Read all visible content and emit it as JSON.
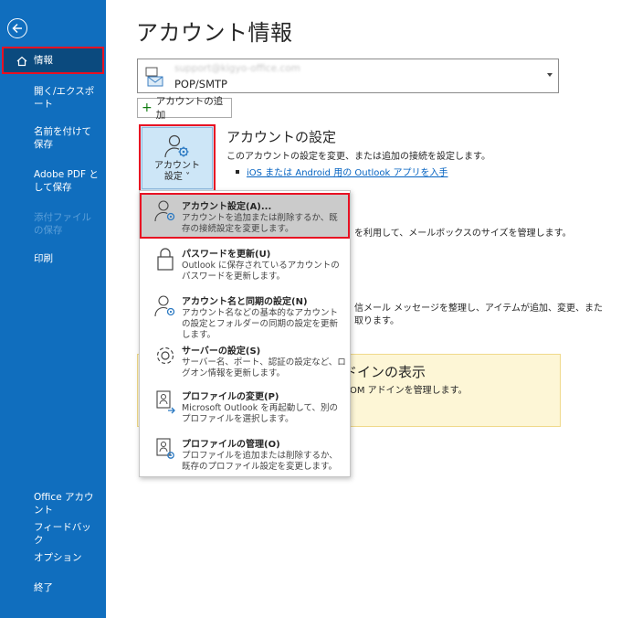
{
  "sidebar": {
    "back_icon": "arrow-left-circle-icon",
    "items": [
      {
        "label": "情報",
        "state": "active",
        "icon": "home-icon"
      },
      {
        "label": "開く/エクスポート",
        "state": "normal"
      },
      {
        "label": "名前を付けて保存",
        "state": "normal"
      },
      {
        "label": "Adobe PDF として保存",
        "state": "normal"
      },
      {
        "label": "添付ファイルの保存",
        "state": "disabled"
      },
      {
        "label": "印刷",
        "state": "normal"
      },
      {
        "label": "Office アカウント",
        "state": "normal"
      },
      {
        "label": "フィードバック",
        "state": "normal"
      },
      {
        "label": "オプション",
        "state": "normal"
      },
      {
        "label": "終了",
        "state": "normal"
      }
    ]
  },
  "main": {
    "title": "アカウント情報",
    "account": {
      "email": "support@kigyo-office.com",
      "type": "POP/SMTP",
      "icon": "mail-account-icon"
    },
    "add_account_label": "アカウントの追加",
    "account_settings_button": {
      "line1": "アカウント",
      "line2": "設定 ˅",
      "icon": "person-gear-icon"
    },
    "section": {
      "title": "アカウントの設定",
      "desc": "このアカウントの設定を変更、または追加の接続を設定します。",
      "link": "iOS または Android 用の Outlook アプリを入手"
    },
    "bg_text_1": "を利用して、メールボックスのサイズを管理します。",
    "bg_text_2": "信メール メッセージを整理し、アイテムが追加、変更、また",
    "bg_text_3": "取ります。",
    "addin": {
      "title": "ドインの表示",
      "desc": "COM アドインを管理します。"
    }
  },
  "menu": {
    "items": [
      {
        "title": "アカウント設定(A)...",
        "key": "A",
        "desc": "アカウントを追加または削除するか、既存の接続設定を変更します。",
        "icon": "person-gear-icon",
        "highlighted": true
      },
      {
        "title": "パスワードを更新(U)",
        "key": "U",
        "desc": "Outlook に保存されているアカウントのパスワードを更新します。",
        "icon": "lock-icon"
      },
      {
        "title": "アカウント名と同期の設定(N)",
        "key": "N",
        "desc": "アカウント名などの基本的なアカウントの設定とフォルダーの同期の設定を更新します。",
        "icon": "person-gear-icon"
      },
      {
        "title": "サーバーの設定(S)",
        "key": "S",
        "desc": "サーバー名、ポート、認証の設定など、ログオン情報を更新します。",
        "icon": "gear-icon"
      },
      {
        "title": "プロファイルの変更(P)",
        "key": "P",
        "desc": "Microsoft Outlook を再起動して、別のプロファイルを選択します。",
        "icon": "profile-switch-icon"
      },
      {
        "title": "プロファイルの管理(O)",
        "key": "O",
        "desc": "プロファイルを追加または削除するか、既存のプロファイル設定を変更します。",
        "icon": "profile-manage-icon"
      }
    ]
  },
  "colors": {
    "sidebar": "#106ebe",
    "active_nav": "#0b4a7e",
    "highlight_border": "#e81123",
    "link": "#0563c1",
    "addin_panel": "#fdf6d6"
  }
}
